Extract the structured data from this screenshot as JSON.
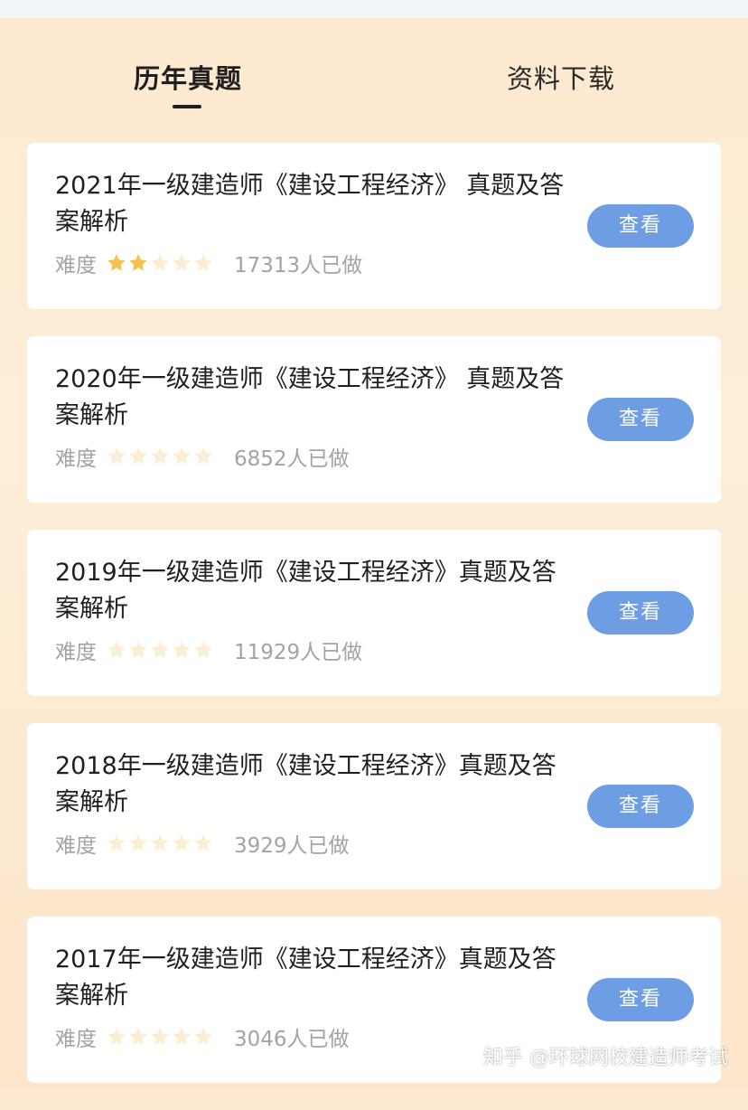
{
  "tabs": [
    {
      "label": "历年真题",
      "active": true
    },
    {
      "label": "资料下载",
      "active": false
    }
  ],
  "difficulty_label": "难度",
  "view_label": "查看",
  "colors": {
    "star_filled": "#f5c34d",
    "star_empty": "#fbefd3",
    "button": "#6d9ee3"
  },
  "items": [
    {
      "title": "2021年一级建造师《建设工程经济》 真题及答案解析",
      "stars": 2,
      "count": "17313人已做"
    },
    {
      "title": "2020年一级建造师《建设工程经济》 真题及答案解析",
      "stars": 0,
      "count": "6852人已做"
    },
    {
      "title": "2019年一级建造师《建设工程经济》真题及答案解析",
      "stars": 0,
      "count": "11929人已做"
    },
    {
      "title": "2018年一级建造师《建设工程经济》真题及答案解析",
      "stars": 0,
      "count": "3929人已做"
    },
    {
      "title": "2017年一级建造师《建设工程经济》真题及答案解析",
      "stars": 0,
      "count": "3046人已做"
    }
  ],
  "watermark": "知乎 @环球网校建造师考试"
}
